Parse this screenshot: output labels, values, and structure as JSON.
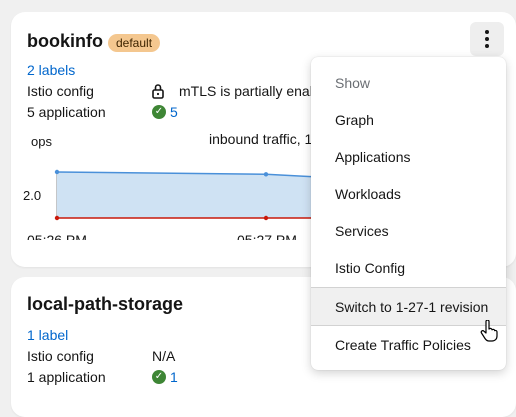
{
  "card1": {
    "title": "bookinfo",
    "badge": "default",
    "labels_link": "2 labels",
    "istio_config_label": "Istio config",
    "istio_config_value": "mTLS is partially enab",
    "apps_label": "5 application",
    "apps_count": "5",
    "chart_data": {
      "type": "line",
      "title": "inbound traffic, 1",
      "ylabel": "ops",
      "y_ticks": [
        "2.0"
      ],
      "x_ticks": [
        "05:26 PM",
        "05:27 PM"
      ],
      "series": [
        {
          "values": [
            2.1,
            2.09,
            2.08
          ],
          "color": "#4a90d9",
          "fill": "#cfe2f3"
        },
        {
          "values": [
            1.9,
            1.9,
            1.9
          ],
          "color": "#c9190b"
        }
      ]
    }
  },
  "card2": {
    "title": "local-path-storage",
    "labels_link": "1 label",
    "istio_config_label": "Istio config",
    "istio_config_value": "N/A",
    "apps_label": "1 application",
    "apps_count": "1"
  },
  "menu": {
    "header": "Show",
    "items": [
      "Graph",
      "Applications",
      "Workloads",
      "Services",
      "Istio Config",
      "Switch to 1-27-1 revision",
      "Create Traffic Policies"
    ]
  },
  "icons": {
    "kebab": "kebab-vertical-icon",
    "lock": "lock-icon",
    "check": "check-circle-icon",
    "cursor": "hand-pointer-icon"
  },
  "colors": {
    "link": "#0066cc",
    "badge": "#f4c78f",
    "success": "#3e8635",
    "line_blue": "#4a90d9",
    "line_red": "#c9190b"
  }
}
